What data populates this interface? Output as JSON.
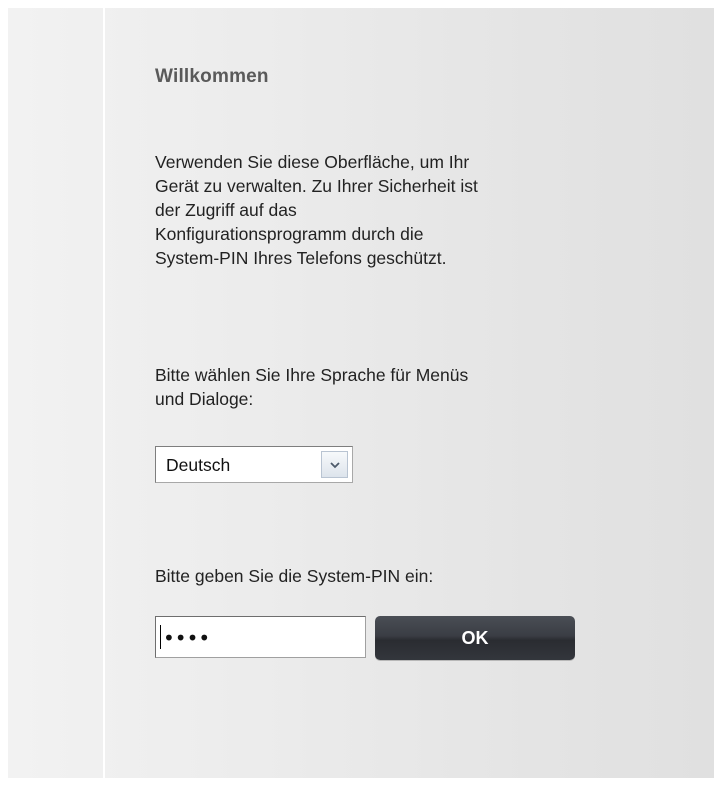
{
  "welcome": {
    "title": "Willkommen",
    "description_lines": [
      "Verwenden Sie diese Oberfläche, um Ihr",
      "Gerät zu verwalten. Zu Ihrer Sicherheit ist",
      "der Zugriff auf das",
      "Konfigurationsprogramm durch die",
      "System-PIN Ihres Telefons geschützt."
    ]
  },
  "language": {
    "label_lines": [
      "Bitte wählen Sie Ihre Sprache für Menüs",
      "und Dialoge:"
    ],
    "selected": "Deutsch",
    "arrow_icon": "chevron-down-icon"
  },
  "pin": {
    "label": "Bitte geben Sie die System-PIN ein:",
    "masked_value": "••••",
    "ok_label": "OK"
  },
  "colors": {
    "button_dark": "#2e3035",
    "title_gray": "#5a5a5a",
    "panel_bg": "#e8e8e8"
  }
}
